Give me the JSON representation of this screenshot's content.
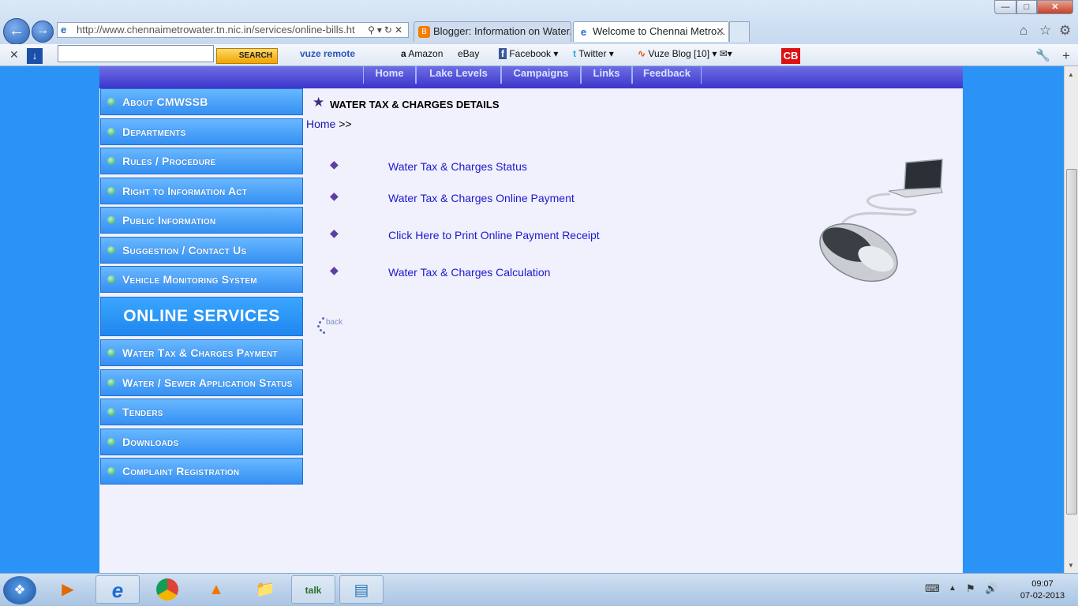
{
  "browser": {
    "address_url": "http://www.chennaimetrowater.tn.nic.in/services/online-bills.ht",
    "tabs": [
      {
        "label": "Blogger: Information on Water..."
      },
      {
        "label": "Welcome to Chennai Metro..."
      }
    ]
  },
  "toolbar": {
    "search_label": "SEARCH",
    "vuze_label": "vuze remote",
    "amazon_label": "Amazon",
    "ebay_label": "eBay",
    "facebook_label": "Facebook",
    "twitter_label": "Twitter",
    "vuzeblog_label": "Vuze Blog",
    "vuzeblog_count": "[10]",
    "cb_label": "CB"
  },
  "site": {
    "topnav": [
      "Home",
      "Lake Levels",
      "Campaigns",
      "Links",
      "Feedback"
    ],
    "sidebar_top": [
      "About CMWSSB",
      "Departments",
      "Rules / Procedure",
      "Right to Information Act",
      "Public Information",
      "Suggestion / Contact Us",
      "Vehicle Monitoring System"
    ],
    "online_services_label": "ONLINE SERVICES",
    "sidebar_bottom": [
      "Water Tax & Charges Payment",
      "Water / Sewer Application Status",
      "Tenders",
      "Downloads",
      "Complaint Registration"
    ],
    "section_title": "WATER TAX & CHARGES DETAILS",
    "breadcrumb_home": "Home",
    "breadcrumb_sep": ">>",
    "links": [
      "Water Tax & Charges Status",
      "Water Tax & Charges Online Payment",
      "Click Here to Print Online Payment Receipt",
      "Water Tax & Charges Calculation"
    ],
    "back_label": "back"
  },
  "taskbar": {
    "time": "09:07",
    "date": "07-02-2013"
  }
}
